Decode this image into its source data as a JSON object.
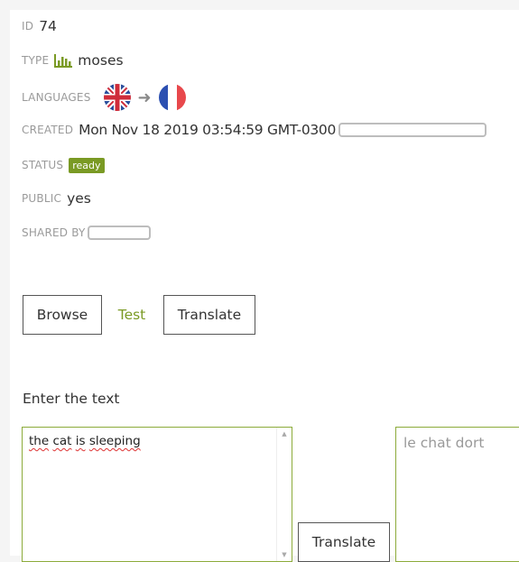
{
  "details": {
    "id_label": "ID",
    "id_value": "74",
    "type_label": "TYPE",
    "type_icon": "bar-chart-icon",
    "type_value": "moses",
    "languages_label": "LANGUAGES",
    "source_flag": "uk-flag-icon",
    "target_flag": "france-flag-icon",
    "created_label": "CREATED",
    "created_value": "Mon Nov 18 2019 03:54:59 GMT-0300",
    "status_label": "STATUS",
    "status_value": "ready",
    "public_label": "PUBLIC",
    "public_value": "yes",
    "shared_by_label": "SHARED BY"
  },
  "tabs": {
    "browse": "Browse",
    "test": "Test",
    "translate": "Translate"
  },
  "tester": {
    "prompt": "Enter the text",
    "source_words": [
      "the",
      "cat",
      "is",
      "sleeping"
    ],
    "translate_button": "Translate",
    "output": "le chat dort"
  },
  "colors": {
    "accent": "#7a9a24",
    "textbox_border": "#8cab3a"
  }
}
